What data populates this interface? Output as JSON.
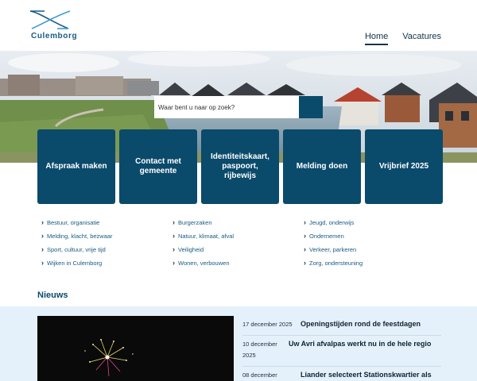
{
  "header": {
    "logo_text": "Culemborg",
    "nav": [
      {
        "label": "Home",
        "active": true
      },
      {
        "label": "Vacatures",
        "active": false
      }
    ]
  },
  "hero": {
    "search_placeholder": "Waar bent u naar op zoek?"
  },
  "tiles": [
    {
      "label": "Afspraak maken"
    },
    {
      "label": "Contact met gemeente"
    },
    {
      "label": "Identiteitskaart, paspoort, rijbewijs"
    },
    {
      "label": "Melding doen"
    },
    {
      "label": "Vrijbrief 2025"
    }
  ],
  "categories": [
    {
      "label": "Bestuur, organisatie"
    },
    {
      "label": "Burgerzaken"
    },
    {
      "label": "Jeugd, onderwijs"
    },
    {
      "label": "Melding, klacht, bezwaar"
    },
    {
      "label": "Natuur, klimaat, afval"
    },
    {
      "label": "Ondernemen"
    },
    {
      "label": "Sport, cultuur, vrije tijd"
    },
    {
      "label": "Veiligheid"
    },
    {
      "label": "Verkeer, parkeren"
    },
    {
      "label": "Wijken in Culemborg"
    },
    {
      "label": "Wonen, verbouwen"
    },
    {
      "label": "Zorg, ondersteuning"
    }
  ],
  "news": {
    "title": "Nieuws",
    "items": [
      {
        "date": "17 december 2025",
        "headline": "Openingstijden rond de feestdagen"
      },
      {
        "date": "10 december 2025",
        "headline": "Uw Avri afvalpas werkt nu in de hele regio"
      },
      {
        "date": "08 december",
        "headline": "Liander selecteert Stationskwartier als"
      }
    ]
  },
  "colors": {
    "primary": "#0a4a6b",
    "link": "#1a5a83",
    "news_background": "#e4f1fb"
  }
}
